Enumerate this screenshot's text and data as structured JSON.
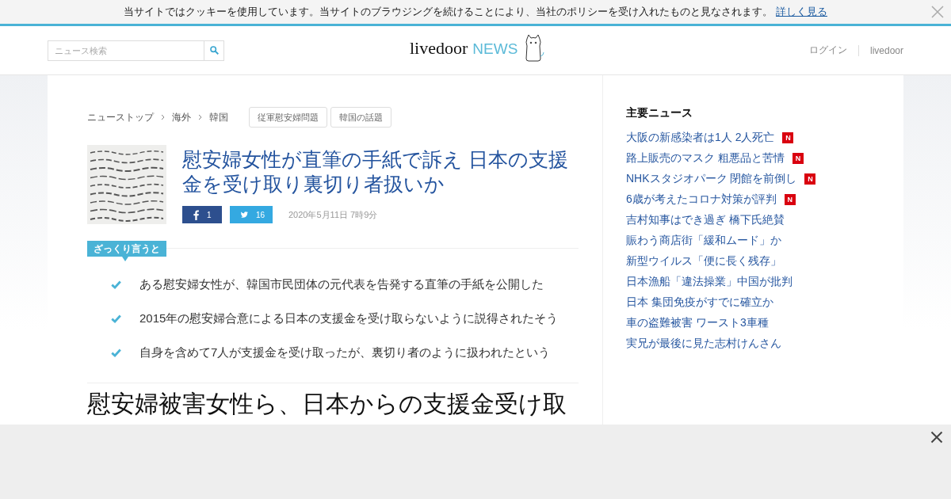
{
  "cookie_bar": {
    "message": "当サイトではクッキーを使用しています。当サイトのブラウジングを続けることにより、当社のポリシーを受け入れたものと見なされます。",
    "link": "詳しく見る"
  },
  "header": {
    "search": {
      "placeholder": "ニュース検索"
    },
    "logo": {
      "brand": "livedoor",
      "suffix": "NEWS"
    },
    "nav": [
      "ログイン",
      "livedoor"
    ]
  },
  "breadcrumbs": [
    "ニューストップ",
    "海外",
    "韓国"
  ],
  "tags": [
    "従軍慰安婦問題",
    "韓国の話題"
  ],
  "article": {
    "title": "慰安婦女性が直筆の手紙で訴え 日本の支援金を受け取り裏切り者扱いか",
    "share": [
      {
        "kind": "facebook",
        "count": "1"
      },
      {
        "kind": "twitter",
        "count": "16"
      }
    ],
    "date": "2020年5月11日 7時9分",
    "summary": {
      "label": "ざっくり言うと",
      "points": [
        "ある慰安婦女性が、韓国市民団体の元代表を告発する直筆の手紙を公開した",
        "2015年の慰安婦合意による日本の支援金を受け取らないように説得されたそう",
        "自身を含めて7人が支援金を受け取ったが、裏切り者のように扱われたという"
      ]
    },
    "subheading": "慰安婦被害女性ら、日本からの支援金受け取"
  },
  "sidebar": {
    "title": "主要ニュース",
    "items": [
      {
        "text": "大阪の新感染者は1人 2人死亡",
        "badge": "N"
      },
      {
        "text": "路上販売のマスク 粗悪品と苦情",
        "badge": "N"
      },
      {
        "text": "NHKスタジオパーク 閉館を前倒し",
        "badge": "N"
      },
      {
        "text": "6歳が考えたコロナ対策が評判",
        "badge": "N"
      },
      {
        "text": "吉村知事はでき過ぎ 橋下氏絶賛"
      },
      {
        "text": "賑わう商店街「緩和ムード」か"
      },
      {
        "text": "新型ウイルス「便に長く残存」"
      },
      {
        "text": "日本漁船「違法操業」中国が批判"
      },
      {
        "text": "日本 集団免疫がすでに確立か"
      },
      {
        "text": "車の盗難被害 ワースト3車種"
      },
      {
        "text": "実兄が最後に見た志村けんさん"
      }
    ]
  }
}
